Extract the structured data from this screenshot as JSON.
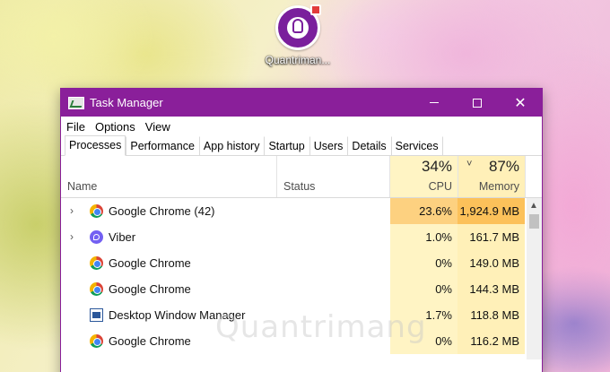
{
  "desktop": {
    "icon_label": "Quantriman..."
  },
  "window": {
    "title": "Task Manager",
    "minimize_icon": "minimize-icon",
    "maximize_icon": "maximize-icon",
    "close_glyph": "✕"
  },
  "menu": {
    "file": "File",
    "options": "Options",
    "view": "View"
  },
  "tabs": [
    {
      "label": "Processes",
      "active": true
    },
    {
      "label": "Performance"
    },
    {
      "label": "App history"
    },
    {
      "label": "Startup"
    },
    {
      "label": "Users"
    },
    {
      "label": "Details"
    },
    {
      "label": "Services"
    }
  ],
  "columns": {
    "name": "Name",
    "status": "Status",
    "cpu_total": "34%",
    "cpu_label": "CPU",
    "mem_total": "87%",
    "mem_label": "Memory",
    "sort_glyph": "˅"
  },
  "processes": [
    {
      "name": "Google Chrome (42)",
      "cpu": "23.6%",
      "memory": "1,924.9 MB",
      "icon": "chrome-icon",
      "expandable": true
    },
    {
      "name": "Viber",
      "cpu": "1.0%",
      "memory": "161.7 MB",
      "icon": "viber-icon",
      "expandable": true
    },
    {
      "name": "Google Chrome",
      "cpu": "0%",
      "memory": "149.0 MB",
      "icon": "chrome-icon",
      "expandable": false
    },
    {
      "name": "Google Chrome",
      "cpu": "0%",
      "memory": "144.3 MB",
      "icon": "chrome-icon",
      "expandable": false
    },
    {
      "name": "Desktop Window Manager",
      "cpu": "1.7%",
      "memory": "118.8 MB",
      "icon": "desktop-window-manager-icon",
      "expandable": false
    },
    {
      "name": "Google Chrome",
      "cpu": "0%",
      "memory": "116.2 MB",
      "icon": "chrome-icon",
      "expandable": false
    }
  ],
  "heat_colors": {
    "cpu_high": "#fdd180",
    "cpu_low": "#fff4c4",
    "mem_high": "#fcc15a",
    "mem_low": "#fff0b8",
    "accent": "#8a1f9a"
  },
  "watermark": "Quantrimang"
}
